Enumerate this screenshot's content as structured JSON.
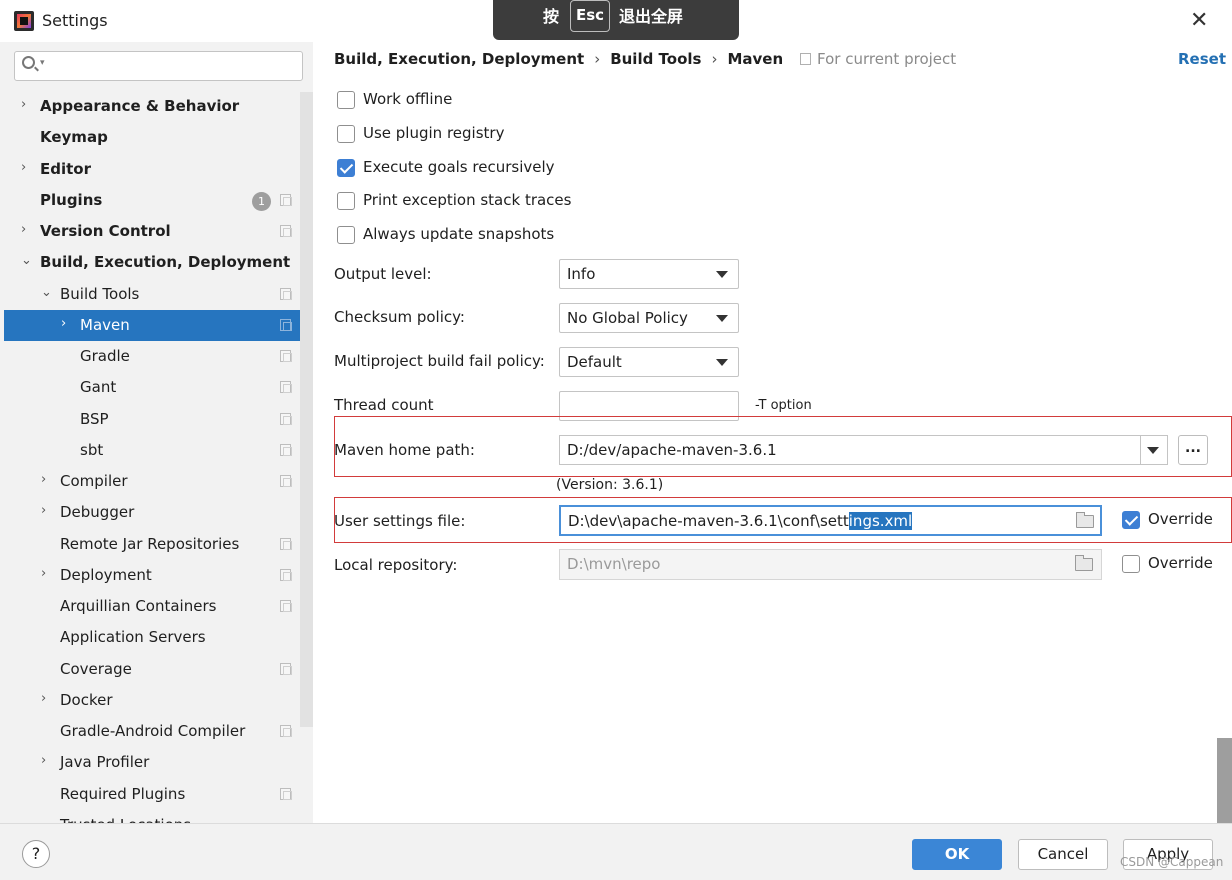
{
  "window": {
    "title": "Settings",
    "close_glyph": "✕"
  },
  "esc_banner": {
    "press": "按",
    "key": "Esc",
    "action": "退出全屏"
  },
  "sidebar": {
    "search_placeholder": "",
    "items": [
      {
        "label": "Appearance & Behavior",
        "arrow": "›",
        "bold": true
      },
      {
        "label": "Keymap",
        "bold": true
      },
      {
        "label": "Editor",
        "arrow": "›",
        "bold": true
      },
      {
        "label": "Plugins",
        "bold": true,
        "badge": "1"
      },
      {
        "label": "Version Control",
        "arrow": "›",
        "bold": true
      },
      {
        "label": "Build, Execution, Deployment",
        "arrow": "⌄",
        "bold": true
      },
      {
        "label": "Build Tools",
        "arrow": "⌄"
      },
      {
        "label": "Maven",
        "arrow": "›",
        "selected": true
      },
      {
        "label": "Gradle"
      },
      {
        "label": "Gant"
      },
      {
        "label": "BSP"
      },
      {
        "label": "sbt"
      },
      {
        "label": "Compiler",
        "arrow": "›"
      },
      {
        "label": "Debugger",
        "arrow": "›"
      },
      {
        "label": "Remote Jar Repositories"
      },
      {
        "label": "Deployment",
        "arrow": "›"
      },
      {
        "label": "Arquillian Containers"
      },
      {
        "label": "Application Servers"
      },
      {
        "label": "Coverage"
      },
      {
        "label": "Docker",
        "arrow": "›"
      },
      {
        "label": "Gradle-Android Compiler"
      },
      {
        "label": "Java Profiler",
        "arrow": "›"
      },
      {
        "label": "Required Plugins"
      },
      {
        "label": "Trusted Locations"
      }
    ]
  },
  "header": {
    "breadcrumb": [
      "Build, Execution, Deployment",
      "Build Tools",
      "Maven"
    ],
    "breadcrumb_sep": "›",
    "scope": "For current project",
    "reset": "Reset"
  },
  "options": {
    "work_offline": {
      "label": "Work offline",
      "checked": false
    },
    "use_plugin_registry": {
      "label": "Use plugin registry",
      "checked": false
    },
    "execute_goals_recursively": {
      "label": "Execute goals recursively",
      "checked": true
    },
    "print_exception": {
      "label": "Print exception stack traces",
      "checked": false
    },
    "always_update": {
      "label": "Always update snapshots",
      "checked": false
    }
  },
  "form": {
    "output_level": {
      "label": "Output level:",
      "value": "Info"
    },
    "checksum_policy": {
      "label": "Checksum policy:",
      "value": "No Global Policy"
    },
    "multiproject_fail": {
      "label": "Multiproject build fail policy:",
      "value": "Default"
    },
    "thread_count": {
      "label": "Thread count",
      "value": "",
      "suffix": "-T option"
    },
    "maven_home": {
      "label": "Maven home path:",
      "value": "D:/dev/apache-maven-3.6.1",
      "browse": "...",
      "version": "(Version: 3.6.1)"
    },
    "user_settings": {
      "label": "User settings file:",
      "value_plain": "D:\\dev\\apache-maven-3.6.1\\conf\\sett",
      "value_selected": "ings.xml",
      "override_label": "Override",
      "override_checked": true
    },
    "local_repo": {
      "label": "Local repository:",
      "value": "D:\\mvn\\repo",
      "override_label": "Override",
      "override_checked": false
    }
  },
  "footer": {
    "help": "?",
    "ok": "OK",
    "cancel": "Cancel",
    "apply": "Apply"
  },
  "watermark": "CSDN @Cappean",
  "colors": {
    "accent": "#2675bf",
    "highlight_box": "#d23b3b",
    "ok_button": "#3b86d6",
    "link": "#2470b3"
  }
}
